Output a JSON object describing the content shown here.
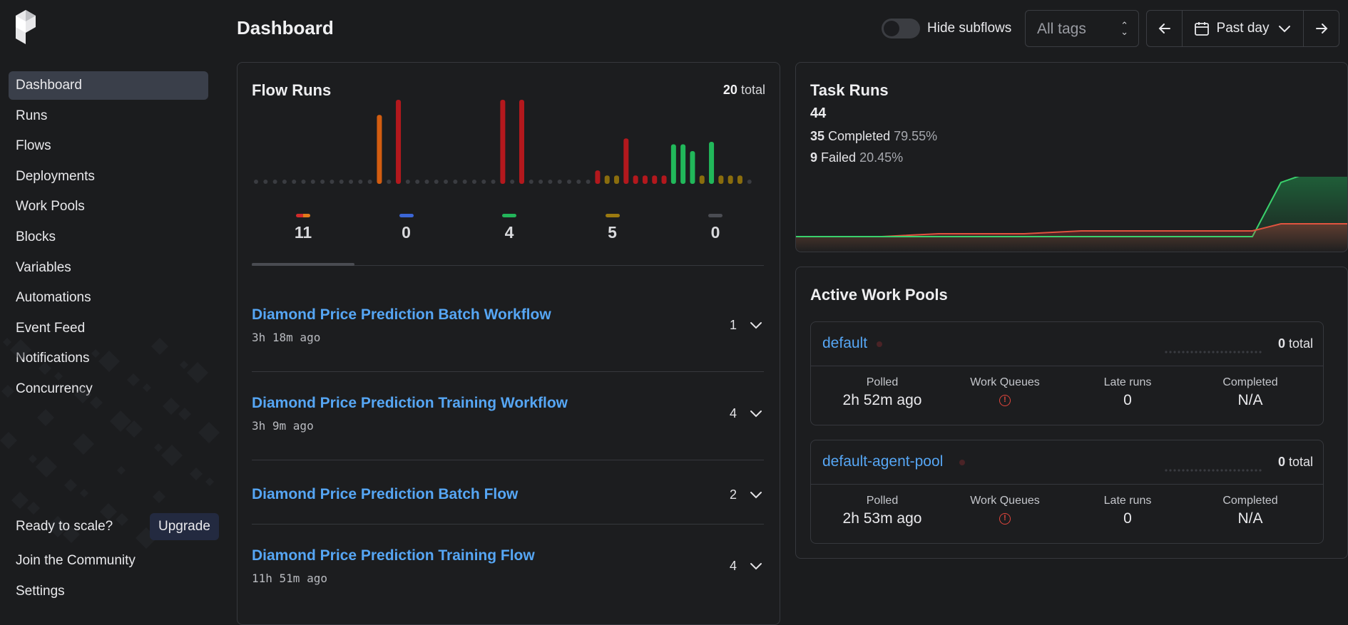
{
  "sidebar": {
    "items": [
      {
        "label": "Dashboard",
        "active": true
      },
      {
        "label": "Runs"
      },
      {
        "label": "Flows"
      },
      {
        "label": "Deployments"
      },
      {
        "label": "Work Pools"
      },
      {
        "label": "Blocks"
      },
      {
        "label": "Variables"
      },
      {
        "label": "Automations"
      },
      {
        "label": "Event Feed"
      },
      {
        "label": "Notifications"
      },
      {
        "label": "Concurrency"
      }
    ],
    "ready_text": "Ready to scale?",
    "upgrade_label": "Upgrade",
    "community_label": "Join the Community",
    "settings_label": "Settings"
  },
  "header": {
    "title": "Dashboard",
    "hide_subflows_label": "Hide subflows",
    "hide_subflows_on": false,
    "tags_placeholder": "All tags",
    "range_label": "Past day"
  },
  "flow_runs": {
    "title": "Flow Runs",
    "total_count": "20",
    "total_suffix": "total",
    "stats": [
      {
        "value": "11",
        "colors": [
          "#d12a2a",
          "#e07b1a"
        ]
      },
      {
        "value": "0",
        "colors": [
          "#3b66d6"
        ]
      },
      {
        "value": "4",
        "colors": [
          "#23b55a"
        ]
      },
      {
        "value": "5",
        "colors": [
          "#9b7a10"
        ]
      },
      {
        "value": "0",
        "colors": [
          "#4a4c52"
        ]
      }
    ],
    "flows": [
      {
        "name": "Diamond Price Prediction Batch Workflow",
        "time": "3h 18m ago",
        "count": "1"
      },
      {
        "name": "Diamond Price Prediction Training Workflow",
        "time": "3h 9m ago",
        "count": "4"
      },
      {
        "name": "Diamond Price Prediction Batch Flow",
        "time": "",
        "count": "2"
      },
      {
        "name": "Diamond Price Prediction Training Flow",
        "time": "11h 51m ago",
        "count": "4"
      }
    ]
  },
  "task_runs": {
    "title": "Task Runs",
    "total": "44",
    "completed_count": "35",
    "completed_label": "Completed",
    "completed_pct": "79.55%",
    "failed_count": "9",
    "failed_label": "Failed",
    "failed_pct": "20.45%"
  },
  "work_pools": {
    "title": "Active Work Pools",
    "columns": [
      "Polled",
      "Work Queues",
      "Late runs",
      "Completed"
    ],
    "pools": [
      {
        "name": "default",
        "total_count": "0",
        "total_suffix": "total",
        "polled": "2h 52m ago",
        "late_runs": "0",
        "completed": "N/A"
      },
      {
        "name": "default-agent-pool",
        "total_count": "0",
        "total_suffix": "total",
        "polled": "2h 53m ago",
        "late_runs": "0",
        "completed": "N/A"
      }
    ]
  },
  "chart_data": {
    "type": "bar",
    "title": "Flow Runs",
    "bars": [
      0,
      0,
      0,
      0,
      0,
      0,
      0,
      0,
      0,
      0,
      0,
      0,
      0,
      {
        "h": 0.82,
        "c": "orange"
      },
      0,
      {
        "h": 1.0,
        "c": "red"
      },
      0,
      0,
      0,
      0,
      0,
      0,
      0,
      0,
      0,
      0,
      {
        "h": 1.0,
        "c": "red"
      },
      0,
      {
        "h": 1.0,
        "c": "red"
      },
      0,
      0,
      0,
      0,
      0,
      0,
      0,
      {
        "h": 0.16,
        "c": "red"
      },
      {
        "h": 0.1,
        "c": "olive"
      },
      {
        "h": 0.1,
        "c": "olive"
      },
      {
        "h": 0.54,
        "c": "red"
      },
      {
        "h": 0.1,
        "c": "red"
      },
      {
        "h": 0.1,
        "c": "red"
      },
      {
        "h": 0.1,
        "c": "red"
      },
      {
        "h": 0.1,
        "c": "red"
      },
      {
        "h": 0.47,
        "c": "green"
      },
      {
        "h": 0.47,
        "c": "green"
      },
      {
        "h": 0.39,
        "c": "green"
      },
      {
        "h": 0.1,
        "c": "olive"
      },
      {
        "h": 0.5,
        "c": "green"
      },
      {
        "h": 0.1,
        "c": "olive"
      },
      {
        "h": 0.1,
        "c": "olive"
      },
      {
        "h": 0.1,
        "c": "olive"
      },
      0
    ]
  }
}
